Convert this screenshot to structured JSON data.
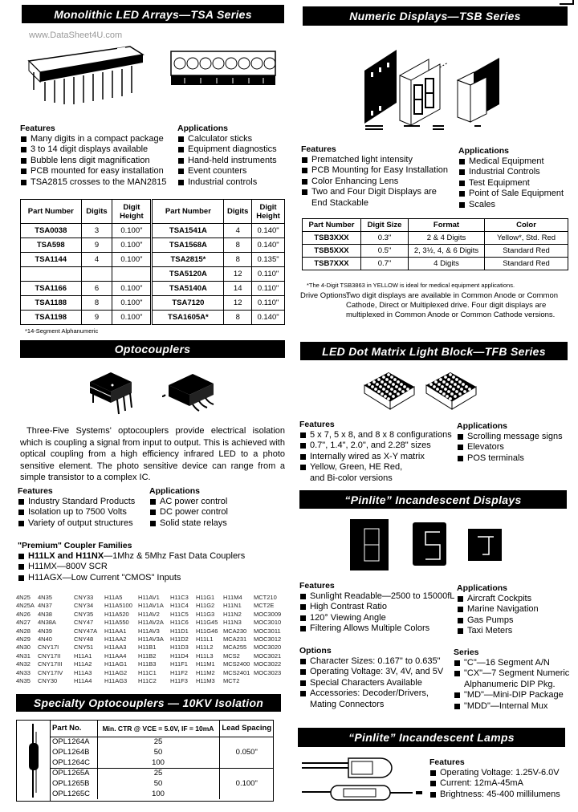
{
  "watermark": "www.DataSheet4U.com",
  "tsa": {
    "title": "Monolithic LED Arrays—TSA Series",
    "features_heading": "Features",
    "features": [
      "Many digits in a compact package",
      "3 to 14 digit displays available",
      "Bubble lens digit magnification",
      "PCB mounted for easy installation",
      "TSA2815 crosses to the MAN2815"
    ],
    "applications_heading": "Applications",
    "applications": [
      "Calculator sticks",
      "Equipment diagnostics",
      "Hand-held instruments",
      "Event counters",
      "Industrial controls"
    ],
    "table": {
      "headers": [
        "Part Number",
        "Digits",
        "Digit Height",
        "Part Number",
        "Digits",
        "Digit Height"
      ],
      "rows": [
        [
          "TSA0038",
          "3",
          "0.100\"",
          "TSA1541A",
          "4",
          "0.140\""
        ],
        [
          "TSA598",
          "9",
          "0.100\"",
          "TSA1568A",
          "8",
          "0.140\""
        ],
        [
          "TSA1144",
          "4",
          "0.100\"",
          "TSA2815*",
          "8",
          "0.135\""
        ],
        [
          "",
          "",
          "",
          "TSA5120A",
          "12",
          "0.110\""
        ],
        [
          "TSA1166",
          "6",
          "0.100\"",
          "TSA5140A",
          "14",
          "0.110\""
        ],
        [
          "TSA1188",
          "8",
          "0.100\"",
          "TSA7120",
          "12",
          "0.110\""
        ],
        [
          "TSA1198",
          "9",
          "0.100\"",
          "TSA1605A*",
          "8",
          "0.140\""
        ]
      ]
    },
    "footnote": "*14-Segment Alphanumeric"
  },
  "tsb": {
    "title": "Numeric Displays—TSB Series",
    "features_heading": "Features",
    "features": [
      "Prematched light intensity",
      "PCB Mounting for Easy Installation",
      "Color Enhancing Lens",
      "Two and Four Digit Displays are|End Stackable"
    ],
    "applications_heading": "Applications",
    "applications": [
      "Medical Equipment",
      "Industrial Controls",
      "Test Equipment",
      "Point of Sale Equipment",
      "Scales"
    ],
    "table": {
      "headers": [
        "Part Number",
        "Digit Size",
        "Format",
        "Color"
      ],
      "rows": [
        [
          "TSB3XXX",
          "0.3\"",
          "2 & 4 Digits",
          "Yellow*, Std. Red"
        ],
        [
          "TSB5XXX",
          "0.5\"",
          "2, 3½, 4, & 6 Digits",
          "Standard Red"
        ],
        [
          "TSB7XXX",
          "0.7\"",
          "4 Digits",
          "Standard Red"
        ]
      ]
    },
    "footnote": "*The 4-Digit TSB3863 in YELLOW is ideal for medical equipment applications.",
    "drive_label": "Drive Options:",
    "drive_text": "Two digit displays are available in Common Anode or Common Cathode, Direct or Multiplexed drive. Four digit displays are multiplexed in Common Anode or Common Cathode versions."
  },
  "opto": {
    "title": "Optocouplers",
    "description": "Three-Five Systems' optocouplers provide electrical isolation which is coupling a signal from input to output. This is achieved with optical coupling from a high efficiency infrared LED to a photo sensitive element. The photo sensitive device can range from a simple transistor to a complex IC.",
    "features_heading": "Features",
    "features": [
      "Industry Standard Products",
      "Isolation up to 7500 Volts",
      "Variety of output structures"
    ],
    "applications_heading": "Applications",
    "applications": [
      "AC power control",
      "DC power control",
      "Solid state relays"
    ],
    "premium_heading": "\"Premium\" Coupler Families",
    "premium": [
      {
        "bold": "H11LX and H11NX",
        "text": "—1Mhz & 5Mhz Fast Data Couplers"
      },
      {
        "bold": "",
        "text": "H11MX—800V SCR"
      },
      {
        "bold": "",
        "text": "H11AGX—Low Current \"CMOS\" Inputs"
      }
    ],
    "part_columns": [
      [
        "4N25",
        "4N25A",
        "4N26",
        "4N27",
        "4N28",
        "4N29",
        "4N30",
        "4N31",
        "4N32",
        "4N33",
        "4N35"
      ],
      [
        "4N35",
        "4N37",
        "4N38",
        "4N38A",
        "4N39",
        "4N40",
        "CNY17I",
        "CNY17II",
        "CNY17III",
        "CNY17IV",
        "CNY30"
      ],
      [
        "CNY33",
        "CNY34",
        "CNY35",
        "CNY47",
        "CNY47A",
        "CNY48",
        "CNY51",
        "H11A1",
        "H11A2",
        "H11A3",
        "H11A4"
      ],
      [
        "H11A5",
        "H11A5100",
        "H11A520",
        "H11A550",
        "H11AA1",
        "H11AA2",
        "H11AA3",
        "H11AA4",
        "H11AG1",
        "H11AG2",
        "H11AG3"
      ],
      [
        "H11AV1",
        "H11AV1A",
        "H11AV2",
        "H11AV2A",
        "H11AV3",
        "H11AV3A",
        "H11B1",
        "H11B2",
        "H11B3",
        "H11C1",
        "H11C2"
      ],
      [
        "H11C3",
        "H11C4",
        "H11C5",
        "H11C6",
        "H11D1",
        "H11D2",
        "H11D3",
        "H11D4",
        "H11F1",
        "H11F2",
        "H11F3"
      ],
      [
        "H11G1",
        "H11G2",
        "H11G3",
        "H11G45",
        "H11G46",
        "H11L1",
        "H11L2",
        "H11L3",
        "H11M1",
        "H11M2",
        "H11M3"
      ],
      [
        "H11M4",
        "H11N1",
        "H11N2",
        "H11N3",
        "MCA230",
        "MCA231",
        "MCA255",
        "MCS2",
        "MCS2400",
        "MCS2401",
        "MCT2"
      ],
      [
        "MCT210",
        "MCT2E",
        "MOC3009",
        "MOC3010",
        "MOC3011",
        "MOC3012",
        "MOC3020",
        "MOC3021",
        "MOC3022",
        "MOC3023",
        ""
      ]
    ]
  },
  "special_opto": {
    "title": "Specialty Optocouplers — 10KV Isolation",
    "headers": [
      "Part No.",
      "Min. CTR @ VCE = 5.0V, IF = 10mA",
      "Lead Spacing"
    ],
    "groups": [
      {
        "parts": [
          "OPL1264A",
          "OPL1264B",
          "OPL1264C"
        ],
        "ctr": [
          "25",
          "50",
          "100"
        ],
        "spacing": "0.050\""
      },
      {
        "parts": [
          "OPL1265A",
          "OPL1265B",
          "OPL1265C"
        ],
        "ctr": [
          "25",
          "50",
          "100"
        ],
        "spacing": "0.100\""
      }
    ]
  },
  "tfb": {
    "title": "LED Dot Matrix Light Block—TFB Series",
    "features_heading": "Features",
    "features": [
      "5 x 7, 5 x 8, and 8 x 8 configurations",
      "0.7\", 1.4\", 2.0\", and 2.28\" sizes",
      "Internally wired as X-Y matrix",
      "Yellow, Green, HE Red,|and Bi-color versions"
    ],
    "applications_heading": "Applications",
    "applications": [
      "Scrolling message signs",
      "Elevators",
      "POS terminals"
    ]
  },
  "pinlite_displays": {
    "title": "“Pinlite” Incandescent Displays",
    "features_heading": "Features",
    "features": [
      "Sunlight Readable—2500 to 15000fL",
      "High Contrast Ratio",
      "120° Viewing Angle",
      "Filtering Allows Multiple Colors"
    ],
    "applications_heading": "Applications",
    "applications": [
      "Aircraft Cockpits",
      "Marine Navigation",
      "Gas Pumps",
      "Taxi Meters"
    ],
    "options_heading": "Options",
    "options": [
      "Character Sizes: 0.167\" to 0.635\"",
      "Operating Voltage: 3V, 4V, and 5V",
      "Special Characters Available",
      "Accessories: Decoder/Drivers,|Mating Connectors"
    ],
    "series_heading": "Series",
    "series": [
      "\"C\"—16 Segment A/N",
      "\"CX\"—7 Segment Numeric|Alphanumeric DIP Pkg.",
      "\"MD\"—Mini-DIP Package",
      "\"MDD\"—Internal Mux"
    ]
  },
  "pinlite_lamps": {
    "title": "“Pinlite” Incandescent Lamps",
    "features_heading": "Features",
    "features": [
      "Operating Voltage: 1.25V-6.0V",
      "Current: 12mA-45mA",
      "Brightness: 45-400 millilumens"
    ]
  }
}
